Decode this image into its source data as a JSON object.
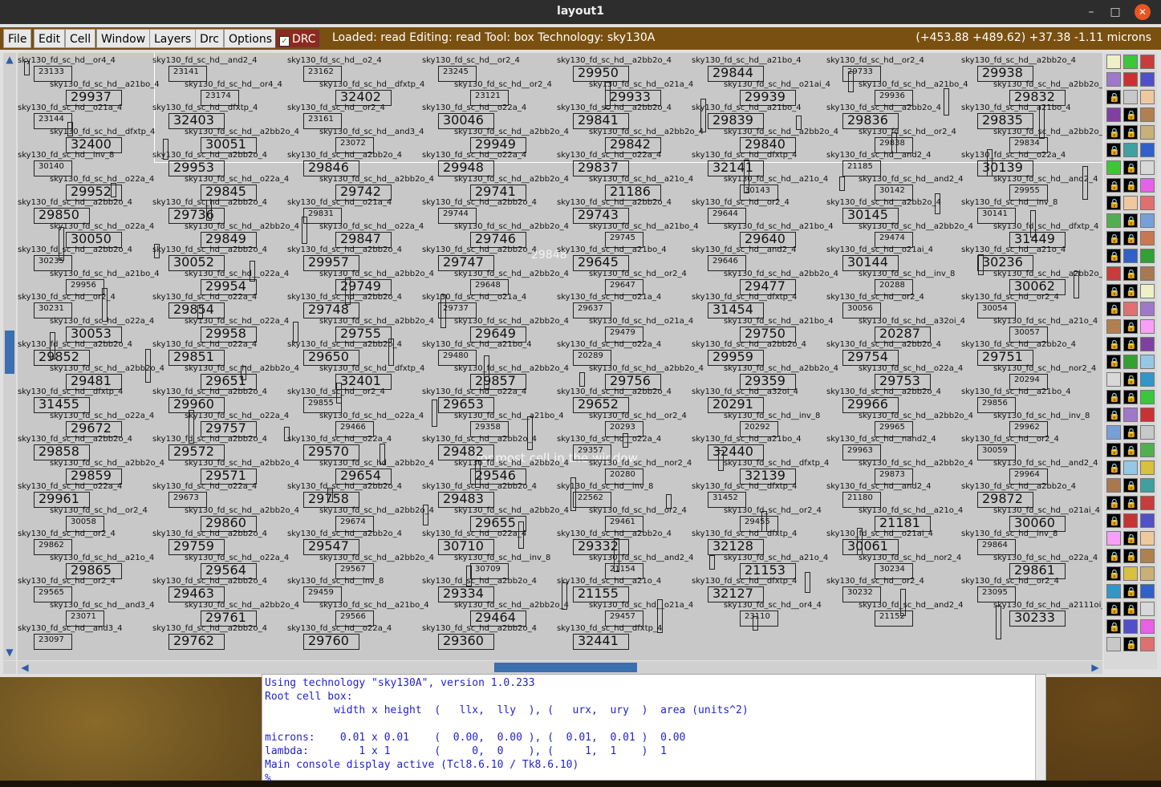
{
  "window": {
    "title": "layout1"
  },
  "window_controls": {
    "minimize": "–",
    "maximize": "□",
    "close": "✕"
  },
  "menu": {
    "items": [
      "File",
      "Edit",
      "Cell",
      "Window",
      "Layers",
      "Drc",
      "Options"
    ],
    "drc_toggle": "DRC"
  },
  "status": {
    "text": "Loaded: read  Editing: read  Tool: box   Technology: sky130A",
    "coords": "(+453.88 +489.62) +37.38 -1.11 microns"
  },
  "canvas": {
    "overlay_label": "Topmost cell in the window",
    "box_label": "29848"
  },
  "cells": [
    {
      "name": "sky130_fd_sc_hd__or4_4",
      "id": "23133",
      "small": true
    },
    {
      "name": "sky130_fd_sc_hd__and2_4",
      "id": "23141",
      "small": true
    },
    {
      "name": "sky130_fd_sc_hd__o2_4",
      "id": "23162",
      "small": true
    },
    {
      "name": "sky130_fd_sc_hd__or2_4",
      "id": "23245",
      "small": true
    },
    {
      "name": "sky130_fd_sc_hd__a2bb2o_4",
      "id": "29950"
    },
    {
      "name": "sky130_fd_sc_hd__a21bo_4",
      "id": "29844"
    },
    {
      "name": "sky130_fd_sc_hd__or2_4",
      "id": "29733",
      "small": true
    },
    {
      "name": "sky130_fd_sc_hd__a2bb2o_4",
      "id": "29938"
    },
    {
      "name": "sky130_fd_sc_hd__a21bo_4",
      "id": "29937"
    },
    {
      "name": "sky130_fd_sc_hd__or4_4",
      "id": "23174",
      "small": true
    },
    {
      "name": "sky130_fd_sc_hd__dfxtp_4",
      "id": "32402"
    },
    {
      "name": "sky130_fd_sc_hd__or2_4",
      "id": "23121",
      "small": true
    },
    {
      "name": "sky130_fd_sc_hd__o21a_4",
      "id": "29933"
    },
    {
      "name": "sky130_fd_sc_hd__o21ai_4",
      "id": "29939"
    },
    {
      "name": "sky130_fd_sc_hd__a21bo_4",
      "id": "29936",
      "small": true
    },
    {
      "name": "sky130_fd_sc_hd__a2bb2o_4",
      "id": "29832"
    },
    {
      "name": "sky130_fd_sc_hd__o21a_4",
      "id": "23144",
      "small": true
    },
    {
      "name": "sky130_fd_sc_hd__dfxtp_4",
      "id": "32403"
    },
    {
      "name": "sky130_fd_sc_hd__or2_4",
      "id": "23161",
      "small": true
    },
    {
      "name": "sky130_fd_sc_hd__o22a_4",
      "id": "30046"
    },
    {
      "name": "sky130_fd_sc_hd__a2bb2o_4",
      "id": "29841"
    },
    {
      "name": "sky130_fd_sc_hd__a21bo_4",
      "id": "29839"
    },
    {
      "name": "sky130_fd_sc_hd__a2bb2o_4",
      "id": "29836"
    },
    {
      "name": "sky130_fd_sc_hd__a21bo_4",
      "id": "29835"
    },
    {
      "name": "sky130_fd_sc_hd__dfxtp_4",
      "id": "32400"
    },
    {
      "name": "sky130_fd_sc_hd__a2bb2o_4",
      "id": "30051"
    },
    {
      "name": "sky130_fd_sc_hd__and3_4",
      "id": "23072",
      "small": true
    },
    {
      "name": "sky130_fd_sc_hd__a2bb2o_4",
      "id": "29949"
    },
    {
      "name": "sky130_fd_sc_hd__a2bb2o_4",
      "id": "29842"
    },
    {
      "name": "sky130_fd_sc_hd__a2bb2o_4",
      "id": "29840"
    },
    {
      "name": "sky130_fd_sc_hd__or2_4",
      "id": "29838",
      "small": true
    },
    {
      "name": "sky130_fd_sc_hd__a2bb2o_4",
      "id": "29834",
      "small": true
    },
    {
      "name": "sky130_fd_sc_hd__inv_8",
      "id": "30140",
      "small": true
    },
    {
      "name": "sky130_fd_sc_hd__a2bb2o_4",
      "id": "29953"
    },
    {
      "name": "sky130_fd_sc_hd__a2bb2o_4",
      "id": "29846"
    },
    {
      "name": "sky130_fd_sc_hd__o22a_4",
      "id": "29948"
    },
    {
      "name": "sky130_fd_sc_hd__o22a_4",
      "id": "29837"
    },
    {
      "name": "sky130_fd_sc_hd__dfxtp_4",
      "id": "32141"
    },
    {
      "name": "sky130_fd_sc_hd__and2_4",
      "id": "21185",
      "small": true
    },
    {
      "name": "sky130_fd_sc_hd__o22a_4",
      "id": "30139"
    },
    {
      "name": "sky130_fd_sc_hd__o22a_4",
      "id": "29952"
    },
    {
      "name": "sky130_fd_sc_hd__o22a_4",
      "id": "29845"
    },
    {
      "name": "sky130_fd_sc_hd__a2bb2o_4",
      "id": "29742"
    },
    {
      "name": "sky130_fd_sc_hd__a2bb2o_4",
      "id": "29741"
    },
    {
      "name": "sky130_fd_sc_hd__a21o_4",
      "id": "21186"
    },
    {
      "name": "sky130_fd_sc_hd__a21o_4",
      "id": "30143",
      "small": true
    },
    {
      "name": "sky130_fd_sc_hd__and2_4",
      "id": "30142",
      "small": true
    },
    {
      "name": "sky130_fd_sc_hd__and2_4",
      "id": "29955",
      "small": true
    },
    {
      "name": "sky130_fd_sc_hd__a2bb2o_4",
      "id": "29850"
    },
    {
      "name": "sky130_fd_sc_hd__a2bb2o_4",
      "id": "29736"
    },
    {
      "name": "sky130_fd_sc_hd__o21a_4",
      "id": "29831",
      "small": true
    },
    {
      "name": "sky130_fd_sc_hd__a2bb2o_4",
      "id": "29744",
      "small": true
    },
    {
      "name": "sky130_fd_sc_hd__a2bb2o_4",
      "id": "29743"
    },
    {
      "name": "sky130_fd_sc_hd__or2_4",
      "id": "29644",
      "small": true
    },
    {
      "name": "sky130_fd_sc_hd__a2bb2o_4",
      "id": "30145"
    },
    {
      "name": "sky130_fd_sc_hd__inv_8",
      "id": "30141",
      "small": true
    },
    {
      "name": "sky130_fd_sc_hd__o22a_4",
      "id": "30050"
    },
    {
      "name": "sky130_fd_sc_hd__a2bb2o_4",
      "id": "29849"
    },
    {
      "name": "sky130_fd_sc_hd__o22a_4",
      "id": "29847"
    },
    {
      "name": "sky130_fd_sc_hd__a2bb2o_4",
      "id": "29746"
    },
    {
      "name": "sky130_fd_sc_hd__a21bo_4",
      "id": "29745",
      "small": true
    },
    {
      "name": "sky130_fd_sc_hd__a21bo_4",
      "id": "29640"
    },
    {
      "name": "sky130_fd_sc_hd__a2bb2o_4",
      "id": "29474",
      "small": true
    },
    {
      "name": "sky130_fd_sc_hd__dfxtp_4",
      "id": "31449"
    },
    {
      "name": "sky130_fd_sc_hd__a2bb2o_4",
      "id": "30235",
      "small": true
    },
    {
      "name": "sky130_fd_sc_hd__a2bb2o_4",
      "id": "30052"
    },
    {
      "name": "sky130_fd_sc_hd__a2bb2o_4",
      "id": "29957"
    },
    {
      "name": "sky130_fd_sc_hd__a2bb2o_4",
      "id": "29747"
    },
    {
      "name": "sky130_fd_sc_hd__a21bo_4",
      "id": "29645"
    },
    {
      "name": "sky130_fd_sc_hd__and2_4",
      "id": "29646",
      "small": true
    },
    {
      "name": "sky130_fd_sc_hd__o21ai_4",
      "id": "30144"
    },
    {
      "name": "sky130_fd_sc_hd__a21o_4",
      "id": "30236"
    },
    {
      "name": "sky130_fd_sc_hd__a21bo_4",
      "id": "29956",
      "small": true
    },
    {
      "name": "sky130_fd_sc_hd__o22a_4",
      "id": "29954"
    },
    {
      "name": "sky130_fd_sc_hd__a2bb2o_4",
      "id": "29749"
    },
    {
      "name": "sky130_fd_sc_hd__a2bb2o_4",
      "id": "29648",
      "small": true
    },
    {
      "name": "sky130_fd_sc_hd__or2_4",
      "id": "29647",
      "small": true
    },
    {
      "name": "sky130_fd_sc_hd__a2bb2o_4",
      "id": "29477"
    },
    {
      "name": "sky130_fd_sc_hd__inv_8",
      "id": "20288",
      "small": true
    },
    {
      "name": "sky130_fd_sc_hd__a2bb2o_4",
      "id": "30062"
    },
    {
      "name": "sky130_fd_sc_hd__or2_4",
      "id": "30231",
      "small": true
    },
    {
      "name": "sky130_fd_sc_hd__o22a_4",
      "id": "29854"
    },
    {
      "name": "sky130_fd_sc_hd__a2bb2o_4",
      "id": "29748"
    },
    {
      "name": "sky130_fd_sc_hd__o21a_4",
      "id": "29737",
      "small": true
    },
    {
      "name": "sky130_fd_sc_hd__o21a_4",
      "id": "29637",
      "small": true
    },
    {
      "name": "sky130_fd_sc_hd__dfxtp_4",
      "id": "31454"
    },
    {
      "name": "sky130_fd_sc_hd__or2_4",
      "id": "30056",
      "small": true
    },
    {
      "name": "sky130_fd_sc_hd__or2_4",
      "id": "30054",
      "small": true
    },
    {
      "name": "sky130_fd_sc_hd__o22a_4",
      "id": "30053"
    },
    {
      "name": "sky130_fd_sc_hd__o22a_4",
      "id": "29958"
    },
    {
      "name": "sky130_fd_sc_hd__a2bb2o_4",
      "id": "29755"
    },
    {
      "name": "sky130_fd_sc_hd__a2bb2o_4",
      "id": "29649"
    },
    {
      "name": "sky130_fd_sc_hd__o21a_4",
      "id": "29479",
      "small": true
    },
    {
      "name": "sky130_fd_sc_hd__a21bo_4",
      "id": "29750"
    },
    {
      "name": "sky130_fd_sc_hd__a32oi_4",
      "id": "20287"
    },
    {
      "name": "sky130_fd_sc_hd__a21o_4",
      "id": "30057",
      "small": true
    },
    {
      "name": "sky130_fd_sc_hd__a2bb2o_4",
      "id": "29852"
    },
    {
      "name": "sky130_fd_sc_hd__o22a_4",
      "id": "29851"
    },
    {
      "name": "sky130_fd_sc_hd__a2bb2o_4",
      "id": "29650"
    },
    {
      "name": "sky130_fd_sc_hd__a21bo_4",
      "id": "29480",
      "small": true
    },
    {
      "name": "sky130_fd_sc_hd__o22a_4",
      "id": "20289",
      "small": true
    },
    {
      "name": "sky130_fd_sc_hd__a2bb2o_4",
      "id": "29959"
    },
    {
      "name": "sky130_fd_sc_hd__a2bb2o_4",
      "id": "29754"
    },
    {
      "name": "sky130_fd_sc_hd__a2bb2o_4",
      "id": "29751"
    },
    {
      "name": "sky130_fd_sc_hd__a2bb2o_4",
      "id": "29481"
    },
    {
      "name": "sky130_fd_sc_hd__a2bb2o_4",
      "id": "29651"
    },
    {
      "name": "sky130_fd_sc_hd__dfxtp_4",
      "id": "32401"
    },
    {
      "name": "sky130_fd_sc_hd__a2bb2o_4",
      "id": "29857"
    },
    {
      "name": "sky130_fd_sc_hd__a2bb2o_4",
      "id": "29756"
    },
    {
      "name": "sky130_fd_sc_hd__a2bb2o_4",
      "id": "29359"
    },
    {
      "name": "sky130_fd_sc_hd__o22a_4",
      "id": "29753"
    },
    {
      "name": "sky130_fd_sc_hd__nor2_4",
      "id": "20294",
      "small": true
    },
    {
      "name": "sky130_fd_sc_hd__dfxtp_4",
      "id": "31455"
    },
    {
      "name": "sky130_fd_sc_hd__a2bb2o_4",
      "id": "29960"
    },
    {
      "name": "sky130_fd_sc_hd__or2_4",
      "id": "29855",
      "small": true
    },
    {
      "name": "sky130_fd_sc_hd__o22a_4",
      "id": "29653"
    },
    {
      "name": "sky130_fd_sc_hd__a2bb2o_4",
      "id": "29652"
    },
    {
      "name": "sky130_fd_sc_hd__a32oi_4",
      "id": "20291"
    },
    {
      "name": "sky130_fd_sc_hd__a2bb2o_4",
      "id": "29966"
    },
    {
      "name": "sky130_fd_sc_hd__a21bo_4",
      "id": "29856",
      "small": true
    },
    {
      "name": "sky130_fd_sc_hd__o22a_4",
      "id": "29672"
    },
    {
      "name": "sky130_fd_sc_hd__o22a_4",
      "id": "29757"
    },
    {
      "name": "sky130_fd_sc_hd__o22a_4",
      "id": "29466",
      "small": true
    },
    {
      "name": "sky130_fd_sc_hd__a21bo_4",
      "id": "29358",
      "small": true
    },
    {
      "name": "sky130_fd_sc_hd__or2_4",
      "id": "20293",
      "small": true
    },
    {
      "name": "sky130_fd_sc_hd__inv_8",
      "id": "20292",
      "small": true
    },
    {
      "name": "sky130_fd_sc_hd__a2bb2o_4",
      "id": "29965",
      "small": true
    },
    {
      "name": "sky130_fd_sc_hd__inv_8",
      "id": "29962",
      "small": true
    },
    {
      "name": "sky130_fd_sc_hd__a2bb2o_4",
      "id": "29858"
    },
    {
      "name": "sky130_fd_sc_hd__a2bb2o_4",
      "id": "29572"
    },
    {
      "name": "sky130_fd_sc_hd__o22a_4",
      "id": "29570"
    },
    {
      "name": "sky130_fd_sc_hd__a2bb2o_4",
      "id": "29482"
    },
    {
      "name": "sky130_fd_sc_hd__o22a_4",
      "id": "29357",
      "small": true
    },
    {
      "name": "sky130_fd_sc_hd__a21bo_4",
      "id": "32440"
    },
    {
      "name": "sky130_fd_sc_hd__nand2_4",
      "id": "29963",
      "small": true
    },
    {
      "name": "sky130_fd_sc_hd__or2_4",
      "id": "30059",
      "small": true
    },
    {
      "name": "sky130_fd_sc_hd__a2bb2o_4",
      "id": "29859"
    },
    {
      "name": "sky130_fd_sc_hd__a2bb2o_4",
      "id": "29571"
    },
    {
      "name": "sky130_fd_sc_hd__a2bb2o_4",
      "id": "29654"
    },
    {
      "name": "sky130_fd_sc_hd__a2bb2o_4",
      "id": "29546"
    },
    {
      "name": "sky130_fd_sc_hd__nor2_4",
      "id": "20280",
      "small": true
    },
    {
      "name": "sky130_fd_sc_hd__dfxtp_4",
      "id": "32139"
    },
    {
      "name": "sky130_fd_sc_hd__a2bb2o_4",
      "id": "29873",
      "small": true
    },
    {
      "name": "sky130_fd_sc_hd__and2_4",
      "id": "29964",
      "small": true
    },
    {
      "name": "sky130_fd_sc_hd__o22a_4",
      "id": "29961"
    },
    {
      "name": "sky130_fd_sc_hd__o22a_4",
      "id": "29673",
      "small": true
    },
    {
      "name": "sky130_fd_sc_hd__a2bb2o_4",
      "id": "29758"
    },
    {
      "name": "sky130_fd_sc_hd__a2bb2o_4",
      "id": "29483"
    },
    {
      "name": "sky130_fd_sc_hd__inv_8",
      "id": "22562",
      "small": true
    },
    {
      "name": "sky130_fd_sc_hd__dfxtp_4",
      "id": "31452",
      "small": true
    },
    {
      "name": "sky130_fd_sc_hd__and2_4",
      "id": "21180",
      "small": true
    },
    {
      "name": "sky130_fd_sc_hd__a2bb2o_4",
      "id": "29872"
    },
    {
      "name": "sky130_fd_sc_hd__or2_4",
      "id": "30058",
      "small": true
    },
    {
      "name": "sky130_fd_sc_hd__a2bb2o_4",
      "id": "29860"
    },
    {
      "name": "sky130_fd_sc_hd__a2bb2o_4",
      "id": "29674",
      "small": true
    },
    {
      "name": "sky130_fd_sc_hd__a2bb2o_4",
      "id": "29655"
    },
    {
      "name": "sky130_fd_sc_hd__or2_4",
      "id": "29461",
      "small": true
    },
    {
      "name": "sky130_fd_sc_hd__or2_4",
      "id": "29455",
      "small": true
    },
    {
      "name": "sky130_fd_sc_hd__a21o_4",
      "id": "21181"
    },
    {
      "name": "sky130_fd_sc_hd__o21ai_4",
      "id": "30060"
    },
    {
      "name": "sky130_fd_sc_hd__or2_4",
      "id": "29862",
      "small": true
    },
    {
      "name": "sky130_fd_sc_hd__a2bb2o_4",
      "id": "29759"
    },
    {
      "name": "sky130_fd_sc_hd__a2bb2o_4",
      "id": "29547"
    },
    {
      "name": "sky130_fd_sc_hd__o22a_4",
      "id": "30710"
    },
    {
      "name": "sky130_fd_sc_hd__a2bb2o_4",
      "id": "29332"
    },
    {
      "name": "sky130_fd_sc_hd__dfxtp_4",
      "id": "32128"
    },
    {
      "name": "sky130_fd_sc_hd__o21ai_4",
      "id": "30061"
    },
    {
      "name": "sky130_fd_sc_hd__inv_8",
      "id": "29864",
      "small": true
    },
    {
      "name": "sky130_fd_sc_hd__a21o_4",
      "id": "29865"
    },
    {
      "name": "sky130_fd_sc_hd__o22a_4",
      "id": "29564"
    },
    {
      "name": "sky130_fd_sc_hd__a2bb2o_4",
      "id": "29567",
      "small": true
    },
    {
      "name": "sky130_fd_sc_hd__inv_8",
      "id": "30709",
      "small": true
    },
    {
      "name": "sky130_fd_sc_hd__and2_4",
      "id": "21154",
      "small": true
    },
    {
      "name": "sky130_fd_sc_hd__a21o_4",
      "id": "21153"
    },
    {
      "name": "sky130_fd_sc_hd__nor2_4",
      "id": "30234",
      "small": true
    },
    {
      "name": "sky130_fd_sc_hd__o22a_4",
      "id": "29861"
    },
    {
      "name": "sky130_fd_sc_hd__or2_4",
      "id": "29565",
      "small": true
    },
    {
      "name": "sky130_fd_sc_hd__a2bb2o_4",
      "id": "29463"
    },
    {
      "name": "sky130_fd_sc_hd__inv_8",
      "id": "29459",
      "small": true
    },
    {
      "name": "sky130_fd_sc_hd__a2bb2o_4",
      "id": "29334"
    },
    {
      "name": "sky130_fd_sc_hd__a21o_4",
      "id": "21155"
    },
    {
      "name": "sky130_fd_sc_hd__dfxtp_4",
      "id": "32127"
    },
    {
      "name": "sky130_fd_sc_hd__or2_4",
      "id": "30232",
      "small": true
    },
    {
      "name": "sky130_fd_sc_hd__or2_4",
      "id": "23095",
      "small": true
    },
    {
      "name": "sky130_fd_sc_hd__and3_4",
      "id": "23071",
      "small": true
    },
    {
      "name": "sky130_fd_sc_hd__a2bb2o_4",
      "id": "29761"
    },
    {
      "name": "sky130_fd_sc_hd__a21bo_4",
      "id": "29566",
      "small": true
    },
    {
      "name": "sky130_fd_sc_hd__a2bb2o_4",
      "id": "29464"
    },
    {
      "name": "sky130_fd_sc_hd__o21a_4",
      "id": "29457",
      "small": true
    },
    {
      "name": "sky130_fd_sc_hd__or4_4",
      "id": "23110",
      "small": true
    },
    {
      "name": "sky130_fd_sc_hd__and2_4",
      "id": "21152",
      "small": true
    },
    {
      "name": "sky130_fd_sc_hd__a2111oi_4",
      "id": "30233"
    },
    {
      "name": "sky130_fd_sc_hd__and3_4",
      "id": "23097",
      "small": true
    },
    {
      "name": "sky130_fd_sc_hd__a2bb2o_4",
      "id": "29762"
    },
    {
      "name": "sky130_fd_sc_hd__o22a_4",
      "id": "29760"
    },
    {
      "name": "sky130_fd_sc_hd__a2bb2o_4",
      "id": "29360"
    },
    {
      "name": "sky130_fd_sc_hd__dfxtp_4",
      "id": "32441"
    }
  ],
  "layer_colors": [
    "#f0f0c8",
    "#c8c8c8",
    "#c8b078",
    "#a87850",
    "#c83232",
    "#b08050",
    "#32a032",
    "#3ac83a",
    "#f0c8a0",
    "#c87850",
    "#3296c8",
    "#5050c8",
    "#78a0d8",
    "#96c8e6",
    "#c83c3c",
    "#e07070",
    "#8040a0",
    "#40a0a0",
    "#e860e8",
    "#f8a0f8",
    "#d8c040",
    "#d8d8d8",
    "#a078c8",
    "#50b050",
    "#3060c8"
  ],
  "console": {
    "lines": [
      "Using technology \"sky130A\", version 1.0.233",
      "Root cell box:",
      "           width x height  (   llx,  lly  ), (   urx,  ury  )  area (units^2)",
      "",
      "microns:    0.01 x 0.01    (  0.00,  0.00 ), (  0.01,  0.01 )  0.00",
      "lambda:        1 x 1       (     0,  0    ), (     1,  1    )  1",
      "Main console display active (Tcl8.6.10 / Tk8.6.10)",
      "%"
    ]
  }
}
